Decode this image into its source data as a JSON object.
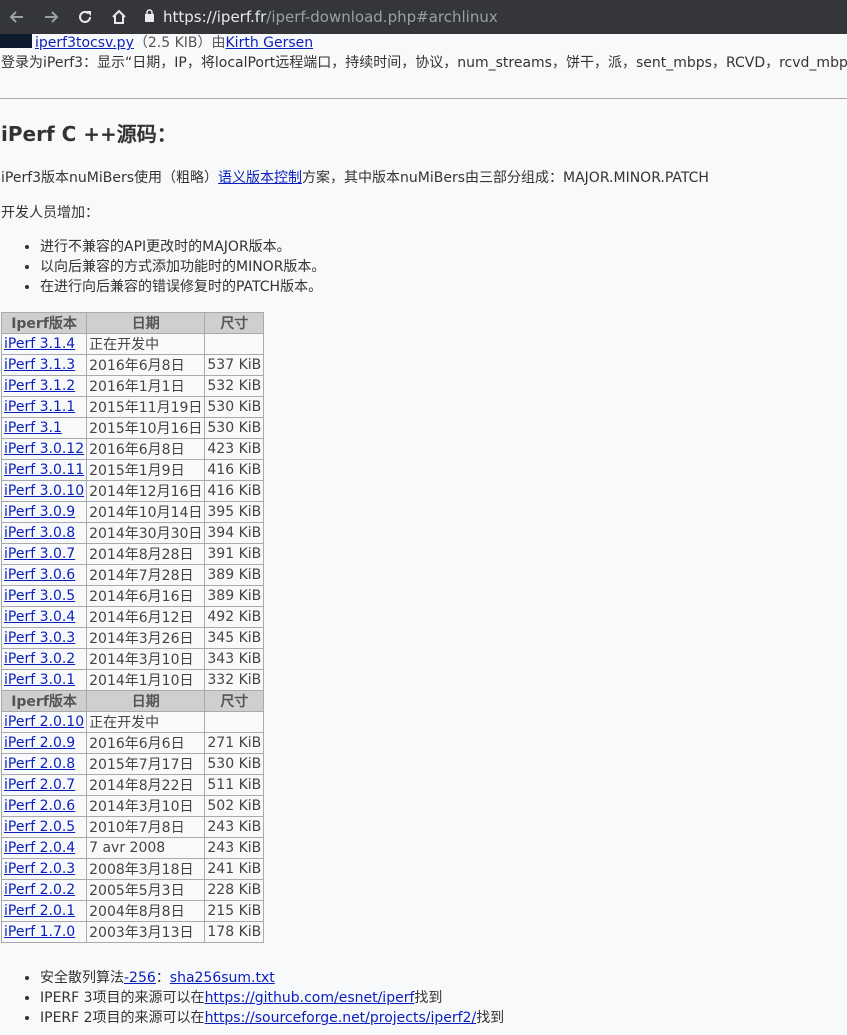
{
  "browser": {
    "url_host": "https://iperf.fr",
    "url_path": "/iperf-download.php#archlinux"
  },
  "top": {
    "script_link": "iperf3tocsv.py",
    "script_size": "（2.5 KIB）由",
    "author_link": "Kirth Gersen"
  },
  "login_line": "登录为iPerf3：显示“日期，IP，将localPort远程端口，持续时间，协议，num_streams，饼干，派，sent_mbps，RCVD，rcvd_mbps”",
  "heading": "iPerf C ++源码：",
  "version_para": {
    "before": "iPerf3版本nuMiBers使用（粗略）",
    "link": "语义版本控制",
    "after": "方案，其中版本nuMiBers由三部分组成：MAJOR.MINOR.PATCH"
  },
  "dev_increase": "开发人员增加：",
  "rules": [
    "进行不兼容的API更改时的MAJOR版本。",
    "以向后兼容的方式添加功能时的MINOR版本。",
    "在进行向后兼容的错误修复时的PATCH版本。"
  ],
  "table": {
    "headers": [
      "Iperf版本",
      "日期",
      "尺寸"
    ],
    "groups": [
      {
        "rows": [
          [
            "iPerf 3.1.4",
            "正在开发中",
            ""
          ],
          [
            "iPerf 3.1.3",
            "2016年6月8日",
            "537 KiB"
          ],
          [
            "iPerf 3.1.2",
            "2016年1月1日",
            "532 KiB"
          ],
          [
            "iPerf 3.1.1",
            "2015年11月19日",
            "530 KiB"
          ],
          [
            "iPerf 3.1",
            "2015年10月16日",
            "530 KiB"
          ],
          [
            "iPerf 3.0.12",
            "2016年6月8日",
            "423 KiB"
          ],
          [
            "iPerf 3.0.11",
            "2015年1月9日",
            "416 KiB"
          ],
          [
            "iPerf 3.0.10",
            "2014年12月16日",
            "416 KiB"
          ],
          [
            "iPerf 3.0.9",
            "2014年10月14日",
            "395 KiB"
          ],
          [
            "iPerf 3.0.8",
            "2014年30月30日",
            "394 KiB"
          ],
          [
            "iPerf 3.0.7",
            "2014年8月28日",
            "391 KiB"
          ],
          [
            "iPerf 3.0.6",
            "2014年7月28日",
            "389 KiB"
          ],
          [
            "iPerf 3.0.5",
            "2014年6月16日",
            "389 KiB"
          ],
          [
            "iPerf 3.0.4",
            "2014年6月12日",
            "492 KiB"
          ],
          [
            "iPerf 3.0.3",
            "2014年3月26日",
            "345 KiB"
          ],
          [
            "iPerf 3.0.2",
            "2014年3月10日",
            "343 KiB"
          ],
          [
            "iPerf 3.0.1",
            "2014年1月10日",
            "332 KiB"
          ]
        ]
      },
      {
        "rows": [
          [
            "iPerf 2.0.10",
            "正在开发中",
            ""
          ],
          [
            "iPerf 2.0.9",
            "2016年6月6日",
            "271 KiB"
          ],
          [
            "iPerf 2.0.8",
            "2015年7月17日",
            "530 KiB"
          ],
          [
            "iPerf 2.0.7",
            "2014年8月22日",
            "511 KiB"
          ],
          [
            "iPerf 2.0.6",
            "2014年3月10日",
            "502 KiB"
          ],
          [
            "iPerf 2.0.5",
            "2010年7月8日",
            "243 KiB"
          ],
          [
            "iPerf 2.0.4",
            "7 avr 2008",
            "243 KiB"
          ],
          [
            "iPerf 2.0.3",
            "2008年3月18日",
            "241 KiB"
          ],
          [
            "iPerf 2.0.2",
            "2005年5月3日",
            "228 KiB"
          ],
          [
            "iPerf 2.0.1",
            "2004年8月8日",
            "215 KiB"
          ],
          [
            "iPerf 1.7.0",
            "2003年3月13日",
            "178 KiB"
          ]
        ]
      }
    ]
  },
  "footer": [
    {
      "before": "安全散列算法",
      "link": "-256",
      "mid": "：",
      "link2": "sha256sum.txt",
      "after": ""
    },
    {
      "before": "IPERF 3项目的来源可以在",
      "link": "https://github.com/esnet/iperf",
      "mid": "",
      "link2": "",
      "after": "找到"
    },
    {
      "before": "IPERF 2项目的来源可以在",
      "link": "https://sourceforge.net/projects/iperf2/",
      "mid": "",
      "link2": "",
      "after": "找到"
    }
  ],
  "icons": {
    "back": "back-arrow-icon",
    "forward": "forward-arrow-icon",
    "reload": "reload-icon",
    "home": "home-icon",
    "lock": "lock-icon"
  }
}
